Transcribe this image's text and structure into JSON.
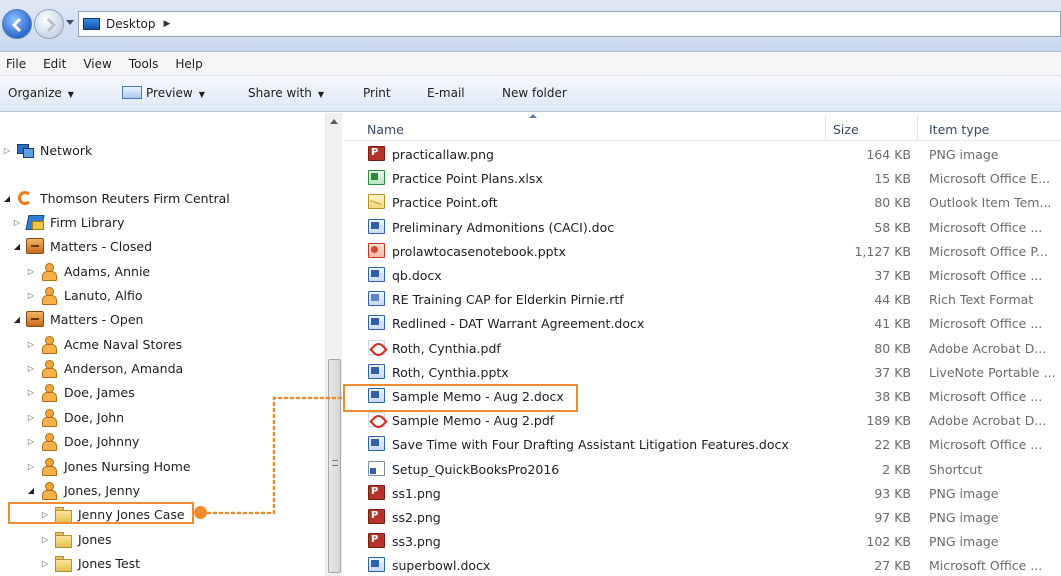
{
  "address": {
    "location": "Desktop"
  },
  "menu": [
    "File",
    "Edit",
    "View",
    "Tools",
    "Help"
  ],
  "toolbar": {
    "organize": "Organize",
    "preview": "Preview",
    "share_with": "Share with",
    "print": "Print",
    "email": "E-mail",
    "new_folder": "New folder"
  },
  "nav": {
    "network": "Network",
    "firm_central": "Thomson Reuters Firm Central",
    "firm_library": "Firm Library",
    "matters_closed": "Matters - Closed",
    "adams": "Adams, Annie",
    "lanuto": "Lanuto, Alfio",
    "matters_open": "Matters - Open",
    "acme": "Acme Naval Stores",
    "anderson": "Anderson, Amanda",
    "doe_james": "Doe, James",
    "doe_john": "Doe, John",
    "doe_johnny": "Doe, Johnny",
    "jones_nursing": "Jones Nursing Home",
    "jones_jenny": "Jones, Jenny",
    "jenny_case": "Jenny Jones Case",
    "jones": "Jones",
    "jones_test": "Jones Test"
  },
  "columns": {
    "name": "Name",
    "size": "Size",
    "type": "Item type"
  },
  "files": [
    {
      "name": "practicallaw.png",
      "size": "164 KB",
      "type": "PNG image",
      "icon": "png"
    },
    {
      "name": "Practice Point Plans.xlsx",
      "size": "15 KB",
      "type": "Microsoft Office E...",
      "icon": "xlsx"
    },
    {
      "name": "Practice Point.oft",
      "size": "80 KB",
      "type": "Outlook Item Tem...",
      "icon": "oft"
    },
    {
      "name": "Preliminary Admonitions (CACI).doc",
      "size": "58 KB",
      "type": "Microsoft Office ...",
      "icon": "doc"
    },
    {
      "name": "prolawtocasenotebook.pptx",
      "size": "1,127 KB",
      "type": "Microsoft Office P...",
      "icon": "pptx"
    },
    {
      "name": "qb.docx",
      "size": "37 KB",
      "type": "Microsoft Office ...",
      "icon": "doc"
    },
    {
      "name": "RE Training CAP for Elderkin  Pirnie.rtf",
      "size": "44 KB",
      "type": "Rich Text Format",
      "icon": "rtf"
    },
    {
      "name": "Redlined - DAT Warrant Agreement.docx",
      "size": "41 KB",
      "type": "Microsoft Office ...",
      "icon": "doc"
    },
    {
      "name": "Roth, Cynthia.pdf",
      "size": "80 KB",
      "type": "Adobe Acrobat D...",
      "icon": "pdf"
    },
    {
      "name": "Roth, Cynthia.pptx",
      "size": "37 KB",
      "type": "LiveNote Portable ...",
      "icon": "doc"
    },
    {
      "name": "Sample Memo - Aug 2.docx",
      "size": "38 KB",
      "type": "Microsoft Office ...",
      "icon": "doc"
    },
    {
      "name": "Sample Memo - Aug 2.pdf",
      "size": "189 KB",
      "type": "Adobe Acrobat D...",
      "icon": "pdf"
    },
    {
      "name": "Save Time with Four Drafting Assistant Litigation Features.docx",
      "size": "22 KB",
      "type": "Microsoft Office ...",
      "icon": "doc"
    },
    {
      "name": "Setup_QuickBooksPro2016",
      "size": "2 KB",
      "type": "Shortcut",
      "icon": "lnk"
    },
    {
      "name": "ss1.png",
      "size": "93 KB",
      "type": "PNG image",
      "icon": "png"
    },
    {
      "name": "ss2.png",
      "size": "97 KB",
      "type": "PNG image",
      "icon": "png"
    },
    {
      "name": "ss3.png",
      "size": "102 KB",
      "type": "PNG image",
      "icon": "png"
    },
    {
      "name": "superbowl.docx",
      "size": "27 KB",
      "type": "Microsoft Office ...",
      "icon": "doc"
    }
  ],
  "colors": {
    "highlight": "#ef8a2e",
    "selection_bg": "#ffffff"
  }
}
